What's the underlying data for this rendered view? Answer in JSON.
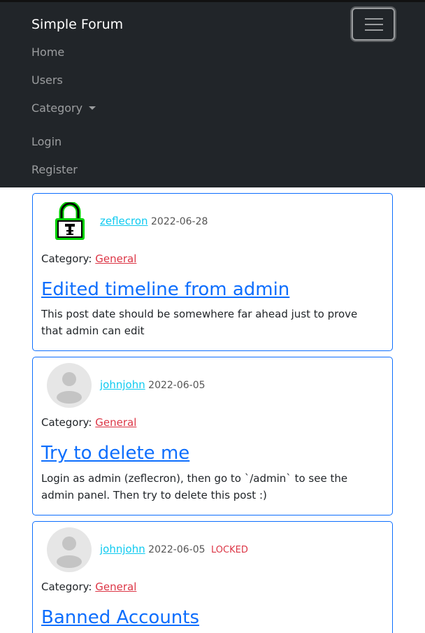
{
  "navbar": {
    "brand": "Simple Forum",
    "items": [
      {
        "label": "Home"
      },
      {
        "label": "Users"
      },
      {
        "label": "Category"
      },
      {
        "label": "Login"
      },
      {
        "label": "Register"
      }
    ]
  },
  "posts": [
    {
      "avatar": "lock-avatar",
      "author": "zeflecron",
      "date": "2022-06-28",
      "status": "",
      "category_label": "Category:",
      "category": "General",
      "title": "Edited timeline from admin",
      "body": "This post date should be somewhere far ahead just to prove that admin can edit"
    },
    {
      "avatar": "default-avatar",
      "author": "johnjohn",
      "date": "2022-06-05",
      "status": "",
      "category_label": "Category:",
      "category": "General",
      "title": "Try to delete me",
      "body": "Login as admin (zeflecron), then go to `/admin` to see the admin panel. Then try to delete this post :)"
    },
    {
      "avatar": "default-avatar",
      "author": "johnjohn",
      "date": "2022-06-05",
      "status": "LOCKED",
      "category_label": "Category:",
      "category": "General",
      "title": "Banned Accounts",
      "body": ""
    }
  ],
  "colors": {
    "navbar_bg": "#212529",
    "card_border": "#0d6efd",
    "title_link": "#0d6efd",
    "author_link": "#0dcaf0",
    "category_link": "#dc3545",
    "locked_badge": "#dc3545"
  }
}
